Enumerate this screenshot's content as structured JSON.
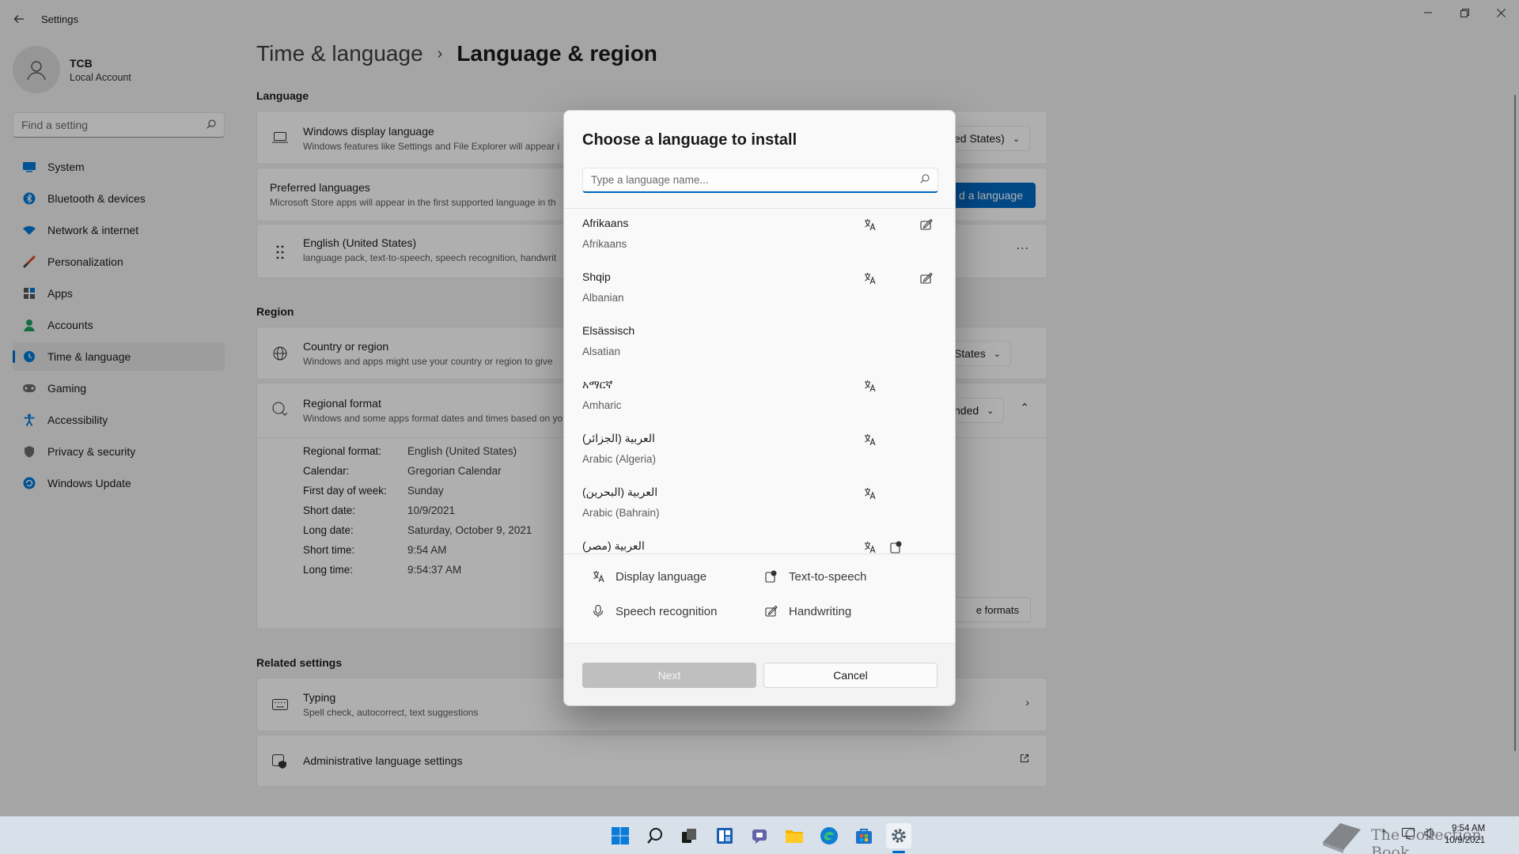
{
  "window": {
    "title": "Settings",
    "back_icon": "back-arrow-icon",
    "controls": [
      "minimize-icon",
      "restore-icon",
      "close-icon"
    ]
  },
  "profile": {
    "name": "TCB",
    "account_type": "Local Account"
  },
  "search": {
    "placeholder": "Find a setting"
  },
  "nav": {
    "items": [
      {
        "label": "System",
        "icon": "monitor-icon",
        "color": "#0078d4"
      },
      {
        "label": "Bluetooth & devices",
        "icon": "bluetooth-icon",
        "color": "#0078d4"
      },
      {
        "label": "Network & internet",
        "icon": "wifi-icon",
        "color": "#0078d4"
      },
      {
        "label": "Personalization",
        "icon": "brush-icon",
        "color": "#d24726"
      },
      {
        "label": "Apps",
        "icon": "apps-icon",
        "color": "#3a3a3a"
      },
      {
        "label": "Accounts",
        "icon": "person-icon",
        "color": "#20a060"
      },
      {
        "label": "Time & language",
        "icon": "globe-clock-icon",
        "color": "#0078d4"
      },
      {
        "label": "Gaming",
        "icon": "gamepad-icon",
        "color": "#6b6b6b"
      },
      {
        "label": "Accessibility",
        "icon": "accessibility-icon",
        "color": "#0078d4"
      },
      {
        "label": "Privacy & security",
        "icon": "shield-icon",
        "color": "#6b6b6b"
      },
      {
        "label": "Windows Update",
        "icon": "update-icon",
        "color": "#0078d4"
      }
    ],
    "active_index": 6
  },
  "page": {
    "breadcrumb_parent": "Time & language",
    "breadcrumb_current": "Language & region",
    "language_header": "Language",
    "display_language": {
      "title": "Windows display language",
      "subtitle": "Windows features like Settings and File Explorer will appear i",
      "value": "ed States)"
    },
    "preferred": {
      "title": "Preferred languages",
      "subtitle": "Microsoft Store apps will appear in the first supported language in th",
      "button": "d a language"
    },
    "installed_language": {
      "title": "English (United States)",
      "subtitle": "language pack, text-to-speech, speech recognition, handwrit",
      "more": "..."
    },
    "region_header": "Region",
    "country": {
      "title": "Country or region",
      "subtitle": "Windows and apps might use your country or region to give",
      "value": "States"
    },
    "regional_format": {
      "title": "Regional format",
      "subtitle": "Windows and some apps format dates and times based on yo",
      "value": "nded",
      "details": [
        {
          "key": "Regional format:",
          "value": "English (United States)"
        },
        {
          "key": "Calendar:",
          "value": "Gregorian Calendar"
        },
        {
          "key": "First day of week:",
          "value": "Sunday"
        },
        {
          "key": "Short date:",
          "value": "10/9/2021"
        },
        {
          "key": "Long date:",
          "value": "Saturday, October 9, 2021"
        },
        {
          "key": "Short time:",
          "value": "9:54 AM"
        },
        {
          "key": "Long time:",
          "value": "9:54:37 AM"
        }
      ],
      "change_button": "e formats"
    },
    "related_header": "Related settings",
    "typing": {
      "title": "Typing",
      "subtitle": "Spell check, autocorrect, text suggestions"
    },
    "admin": {
      "title": "Administrative language settings"
    }
  },
  "dialog": {
    "title": "Choose a language to install",
    "search_placeholder": "Type a language name...",
    "languages": [
      {
        "native": "Afrikaans",
        "english": "Afrikaans",
        "features": [
          "display",
          "handwriting"
        ]
      },
      {
        "native": "Shqip",
        "english": "Albanian",
        "features": [
          "display",
          "handwriting"
        ]
      },
      {
        "native": "Elsässisch",
        "english": "Alsatian",
        "features": []
      },
      {
        "native": "አማርኛ",
        "english": "Amharic",
        "features": [
          "display"
        ]
      },
      {
        "native": "العربية (الجزائر)",
        "english": "Arabic (Algeria)",
        "features": [
          "display"
        ]
      },
      {
        "native": "العربية (البحرين)",
        "english": "Arabic (Bahrain)",
        "features": [
          "display"
        ]
      },
      {
        "native": "العربية (مصر)",
        "english": "",
        "features": [
          "display",
          "tts"
        ]
      }
    ],
    "legend": {
      "display": "Display language",
      "tts": "Text-to-speech",
      "speech": "Speech recognition",
      "handwriting": "Handwriting"
    },
    "next_button": "Next",
    "cancel_button": "Cancel"
  },
  "taskbar": {
    "apps": [
      "start-icon",
      "search-icon",
      "task-view-icon",
      "widgets-icon",
      "chat-icon",
      "file-explorer-icon",
      "edge-icon",
      "store-icon",
      "settings-icon"
    ],
    "time": "9:54 AM",
    "date": "10/9/2021",
    "watermark": "The Collection Book"
  },
  "colors": {
    "accent": "#0067c0",
    "dialog_bg": "#f9f9f9",
    "next_disabled": "#bfbfbf"
  }
}
